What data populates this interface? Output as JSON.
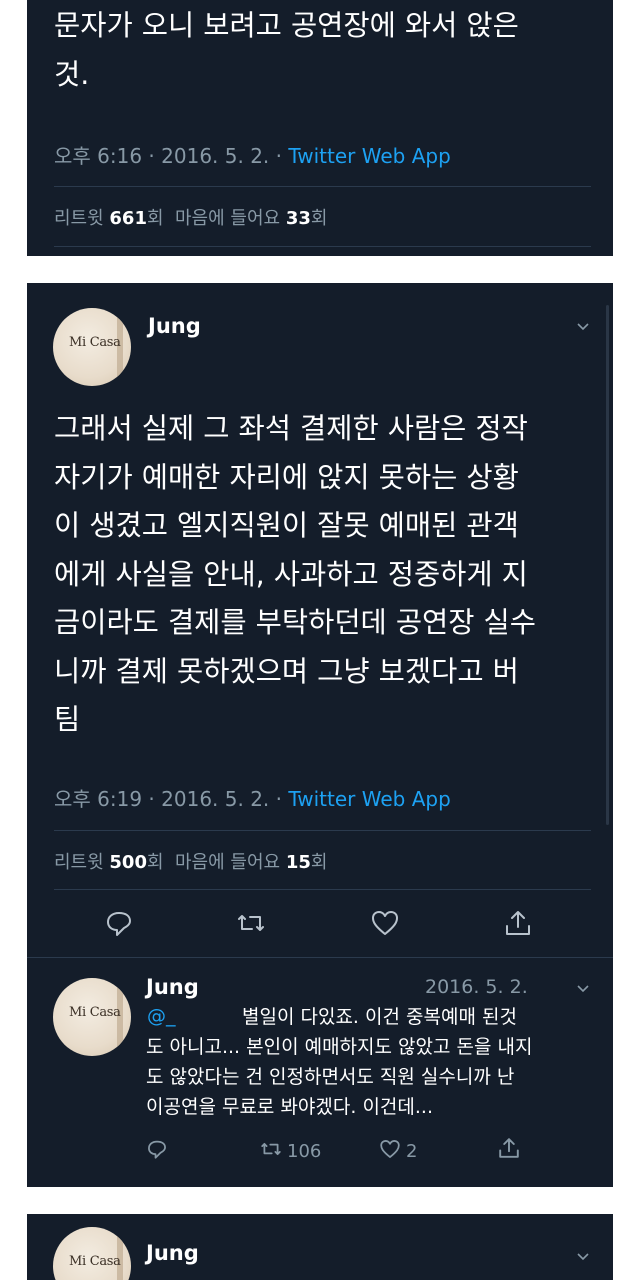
{
  "tweet1": {
    "text": "문자가 오니 보려고 공연장에 와서 앉은\n것.",
    "time": "오후 6:16 · 2016. 5. 2. · ",
    "source": "Twitter Web App",
    "retweet_label": "리트윗 ",
    "retweet_count": "661",
    "count_suffix": "회",
    "like_label": "마음에 들어요 ",
    "like_count": "33"
  },
  "tweet2": {
    "author": "Jung",
    "avatar_text": "Mi Casa",
    "text": "그래서 실제 그 좌석 결제한 사람은 정작\n자기가 예매한 자리에 앉지 못하는 상황\n이 생겼고 엘지직원이 잘못 예매된 관객\n에게 사실을 안내, 사과하고 정중하게 지\n금이라도 결제를 부탁하던데 공연장 실수\n니까 결제 못하겠으며 그냥 보겠다고 버\n팀",
    "time": "오후 6:19 · 2016. 5. 2. · ",
    "source": "Twitter Web App",
    "retweet_label": "리트윗 ",
    "retweet_count": "500",
    "count_suffix": "회",
    "like_label": "마음에 들어요 ",
    "like_count": "15"
  },
  "reply": {
    "author": "Jung",
    "date": "2016. 5. 2.",
    "handle": "@_",
    "line1": "별일이 다있죠. 이건 중복예매 된것",
    "line2": "도 아니고... 본인이 예매하지도 않았고 돈을 내지",
    "line3": "도 않았다는 건 인정하면서도 직원 실수니까 난",
    "line4": "이공연을 무료로 봐야겠다. 이건데...",
    "retweets": "106",
    "likes": "2"
  },
  "tweet3": {
    "author": "Jung"
  },
  "colors": {
    "card_bg": "#141d2a",
    "text_secondary": "#8899a6",
    "accent": "#1da1f2"
  },
  "icons": [
    "reply-icon",
    "retweet-icon",
    "like-icon",
    "share-icon",
    "chevron-down-icon"
  ]
}
